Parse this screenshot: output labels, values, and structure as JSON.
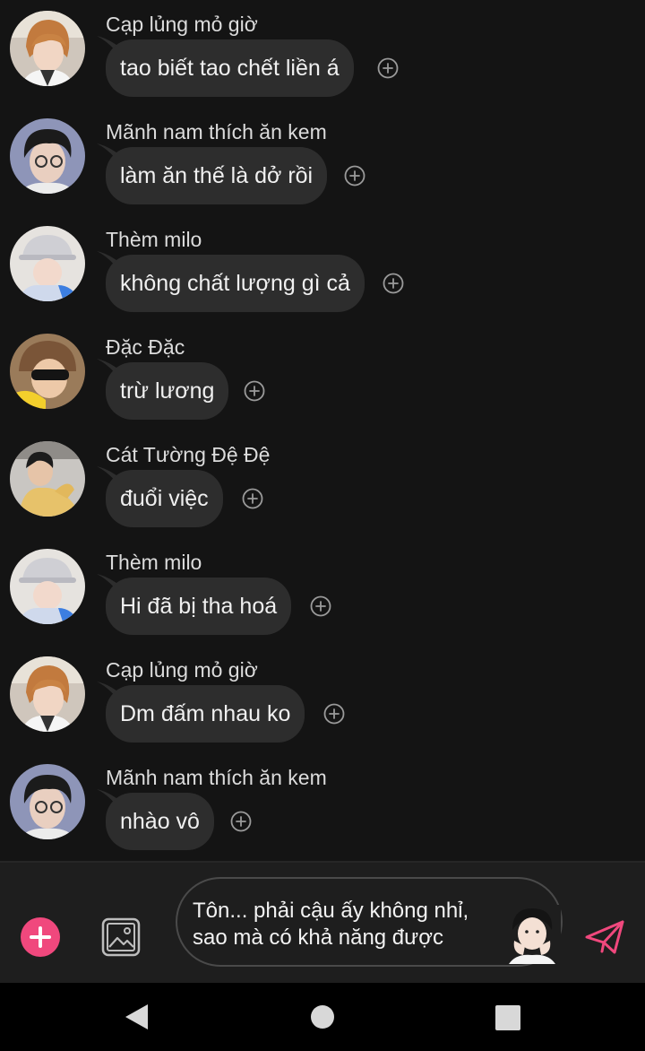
{
  "messages": [
    {
      "sender": "Cạp lủng mỏ giờ",
      "text": "tao biết tao chết liền á",
      "avatar": "avatar-orange-hair"
    },
    {
      "sender": "Mãnh nam thích ăn kem",
      "text": "làm ăn thế là dở rồi",
      "avatar": "avatar-glasses-black-hair"
    },
    {
      "sender": "Thèm milo",
      "text": "không chất lượng gì cả",
      "avatar": "avatar-bucket-hat"
    },
    {
      "sender": "Đặc Đặc",
      "text": "trừ lương",
      "avatar": "avatar-sunglasses-yellow"
    },
    {
      "sender": "Cát Tường Đệ Đệ",
      "text": "đuổi việc",
      "avatar": "avatar-yellow-suit"
    },
    {
      "sender": "Thèm milo",
      "text": "Hi đã bị tha hoá",
      "avatar": "avatar-bucket-hat"
    },
    {
      "sender": "Cạp lủng mỏ giờ",
      "text": "Dm đấm nhau ko",
      "avatar": "avatar-orange-hair"
    },
    {
      "sender": "Mãnh nam thích ăn kem",
      "text": "nhào vô",
      "avatar": "avatar-glasses-black-hair"
    }
  ],
  "input": {
    "value": "Tôn... phải cậu ấy không nhỉ,\nsao mà có khả năng được",
    "avatar": "avatar-boy-hands-on-face"
  },
  "icons": {
    "add": "plus-icon",
    "image": "image-icon",
    "send": "send-icon",
    "reaction": "add-reaction-icon",
    "nav_back": "back-icon",
    "nav_home": "home-icon",
    "nav_recent": "recent-apps-icon"
  },
  "colors": {
    "background": "#141414",
    "bubble": "#2d2d2d",
    "accent": "#f0487d",
    "input_bar": "#1e1e1e",
    "nav_bar": "#000000"
  }
}
